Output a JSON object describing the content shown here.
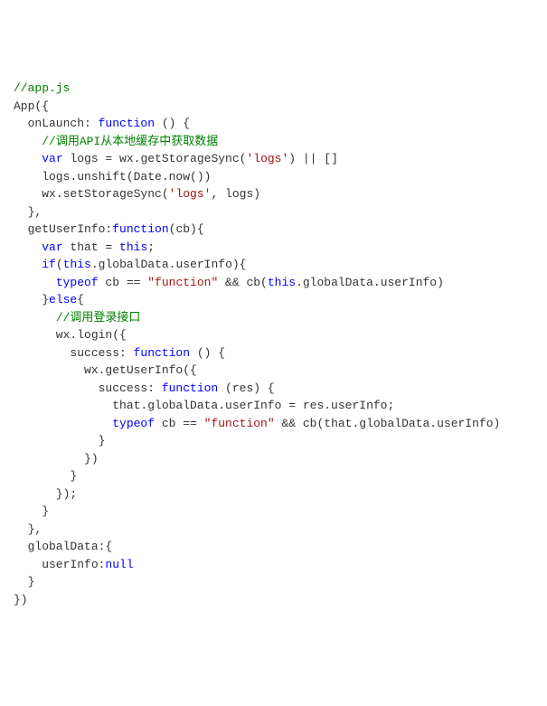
{
  "code": {
    "lines": [
      {
        "tokens": [
          {
            "type": "comment",
            "text": "//app.js"
          }
        ]
      },
      {
        "tokens": [
          {
            "type": "plain",
            "text": "App({"
          }
        ]
      },
      {
        "tokens": [
          {
            "type": "plain",
            "text": "  onLaunch: "
          },
          {
            "type": "keyword",
            "text": "function"
          },
          {
            "type": "plain",
            "text": " () {"
          }
        ]
      },
      {
        "tokens": [
          {
            "type": "plain",
            "text": "    "
          },
          {
            "type": "comment",
            "text": "//调用API从本地缓存中获取数据"
          }
        ]
      },
      {
        "tokens": [
          {
            "type": "plain",
            "text": "    "
          },
          {
            "type": "keyword",
            "text": "var"
          },
          {
            "type": "plain",
            "text": " logs = wx.getStorageSync("
          },
          {
            "type": "string",
            "text": "'logs'"
          },
          {
            "type": "plain",
            "text": ") || []"
          }
        ]
      },
      {
        "tokens": [
          {
            "type": "plain",
            "text": "    logs.unshift(Date.now())"
          }
        ]
      },
      {
        "tokens": [
          {
            "type": "plain",
            "text": "    wx.setStorageSync("
          },
          {
            "type": "string",
            "text": "'logs'"
          },
          {
            "type": "plain",
            "text": ", logs)"
          }
        ]
      },
      {
        "tokens": [
          {
            "type": "plain",
            "text": "  },"
          }
        ]
      },
      {
        "tokens": [
          {
            "type": "plain",
            "text": "  getUserInfo:"
          },
          {
            "type": "keyword",
            "text": "function"
          },
          {
            "type": "plain",
            "text": "(cb){"
          }
        ]
      },
      {
        "tokens": [
          {
            "type": "plain",
            "text": "    "
          },
          {
            "type": "keyword",
            "text": "var"
          },
          {
            "type": "plain",
            "text": " that = "
          },
          {
            "type": "keyword",
            "text": "this"
          },
          {
            "type": "plain",
            "text": ";"
          }
        ]
      },
      {
        "tokens": [
          {
            "type": "plain",
            "text": "    "
          },
          {
            "type": "keyword",
            "text": "if"
          },
          {
            "type": "plain",
            "text": "("
          },
          {
            "type": "keyword",
            "text": "this"
          },
          {
            "type": "plain",
            "text": ".globalData.userInfo){"
          }
        ]
      },
      {
        "tokens": [
          {
            "type": "plain",
            "text": "      "
          },
          {
            "type": "keyword",
            "text": "typeof"
          },
          {
            "type": "plain",
            "text": " cb == "
          },
          {
            "type": "string",
            "text": "\"function\""
          },
          {
            "type": "plain",
            "text": " && cb("
          },
          {
            "type": "keyword",
            "text": "this"
          },
          {
            "type": "plain",
            "text": ".globalData.userInfo)"
          }
        ]
      },
      {
        "tokens": [
          {
            "type": "plain",
            "text": "    }"
          },
          {
            "type": "keyword",
            "text": "else"
          },
          {
            "type": "plain",
            "text": "{"
          }
        ]
      },
      {
        "tokens": [
          {
            "type": "plain",
            "text": "      "
          },
          {
            "type": "comment",
            "text": "//调用登录接口"
          }
        ]
      },
      {
        "tokens": [
          {
            "type": "plain",
            "text": "      wx.login({"
          }
        ]
      },
      {
        "tokens": [
          {
            "type": "plain",
            "text": "        success: "
          },
          {
            "type": "keyword",
            "text": "function"
          },
          {
            "type": "plain",
            "text": " () {"
          }
        ]
      },
      {
        "tokens": [
          {
            "type": "plain",
            "text": "          wx.getUserInfo({"
          }
        ]
      },
      {
        "tokens": [
          {
            "type": "plain",
            "text": "            success: "
          },
          {
            "type": "keyword",
            "text": "function"
          },
          {
            "type": "plain",
            "text": " (res) {"
          }
        ]
      },
      {
        "tokens": [
          {
            "type": "plain",
            "text": "              that.globalData.userInfo = res.userInfo;"
          }
        ]
      },
      {
        "tokens": [
          {
            "type": "plain",
            "text": "              "
          },
          {
            "type": "keyword",
            "text": "typeof"
          },
          {
            "type": "plain",
            "text": " cb == "
          },
          {
            "type": "string",
            "text": "\"function\""
          },
          {
            "type": "plain",
            "text": " && cb(that.globalData.userInfo)"
          }
        ]
      },
      {
        "tokens": [
          {
            "type": "plain",
            "text": "            }"
          }
        ]
      },
      {
        "tokens": [
          {
            "type": "plain",
            "text": "          })"
          }
        ]
      },
      {
        "tokens": [
          {
            "type": "plain",
            "text": "        }"
          }
        ]
      },
      {
        "tokens": [
          {
            "type": "plain",
            "text": "      });"
          }
        ]
      },
      {
        "tokens": [
          {
            "type": "plain",
            "text": "    }"
          }
        ]
      },
      {
        "tokens": [
          {
            "type": "plain",
            "text": "  },"
          }
        ]
      },
      {
        "tokens": [
          {
            "type": "plain",
            "text": "  globalData:{"
          }
        ]
      },
      {
        "tokens": [
          {
            "type": "plain",
            "text": "    userInfo:"
          },
          {
            "type": "literal",
            "text": "null"
          }
        ]
      },
      {
        "tokens": [
          {
            "type": "plain",
            "text": "  }"
          }
        ]
      },
      {
        "tokens": [
          {
            "type": "plain",
            "text": "})"
          }
        ]
      }
    ]
  }
}
